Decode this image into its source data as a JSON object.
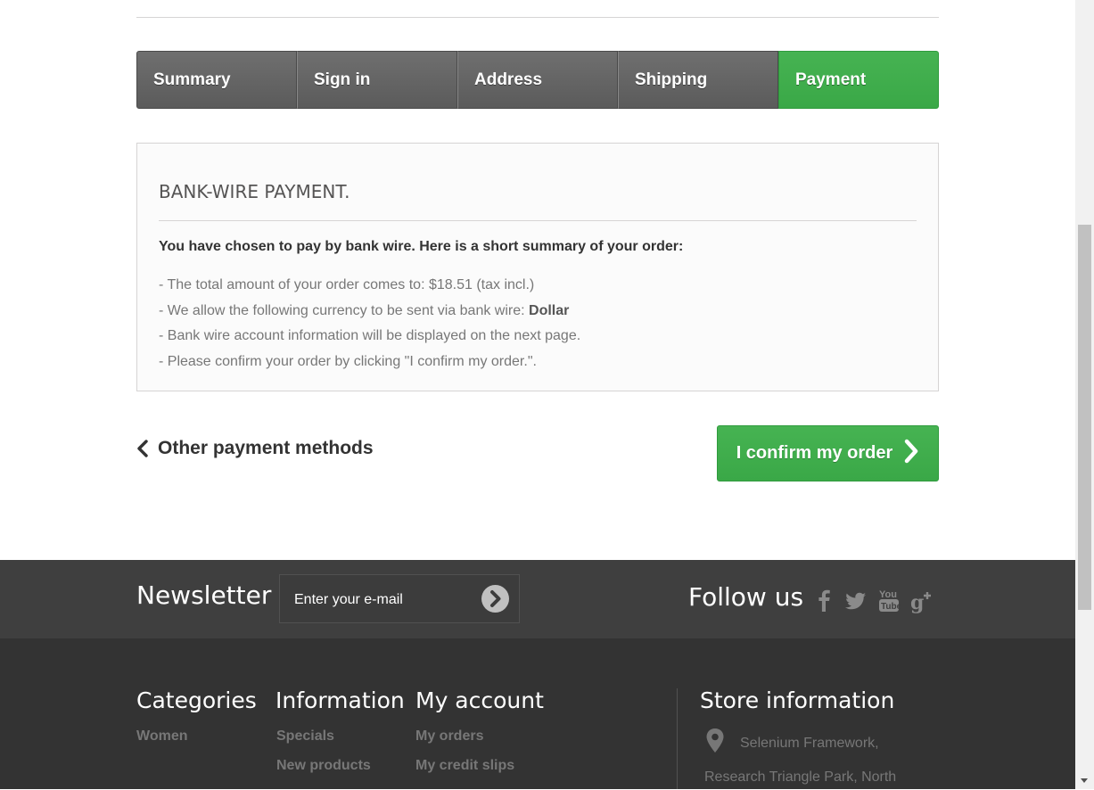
{
  "steps": [
    {
      "label": "Summary"
    },
    {
      "label": "Sign in"
    },
    {
      "label": "Address"
    },
    {
      "label": "Shipping"
    },
    {
      "label": "Payment",
      "active": true
    }
  ],
  "payment_box": {
    "title": "BANK-WIRE PAYMENT.",
    "intro": "You have chosen to pay by bank wire. Here is a short summary of your order:",
    "total_line": "- The total amount of your order comes to: $18.51 (tax incl.)",
    "currency_line_prefix": "- We allow the following currency to be sent via bank wire: ",
    "currency": "Dollar",
    "account_line": "- Bank wire account information will be displayed on the next page.",
    "confirm_line": "- Please confirm your order by clicking \"I confirm my order.\"."
  },
  "actions": {
    "back_label": "Other payment methods",
    "confirm_label": "I confirm my order"
  },
  "newsletter": {
    "title": "Newsletter",
    "placeholder": "Enter your e-mail"
  },
  "follow": {
    "title": "Follow us",
    "icons": [
      "facebook-icon",
      "twitter-icon",
      "youtube-icon",
      "google-plus-icon"
    ]
  },
  "footer": {
    "categories": {
      "title": "Categories",
      "links": [
        "Women"
      ]
    },
    "information": {
      "title": "Information",
      "links": [
        "Specials",
        "New products"
      ]
    },
    "account": {
      "title": "My account",
      "links": [
        "My orders",
        "My credit slips"
      ]
    },
    "store": {
      "title": "Store information",
      "address_line1": "Selenium Framework,",
      "address_line2": "Research Triangle Park, North"
    }
  },
  "colors": {
    "accent_green": "#3aa847",
    "step_gray": "#666666",
    "footer_dark": "#333333",
    "newsletter_band": "#3f3f3f"
  }
}
